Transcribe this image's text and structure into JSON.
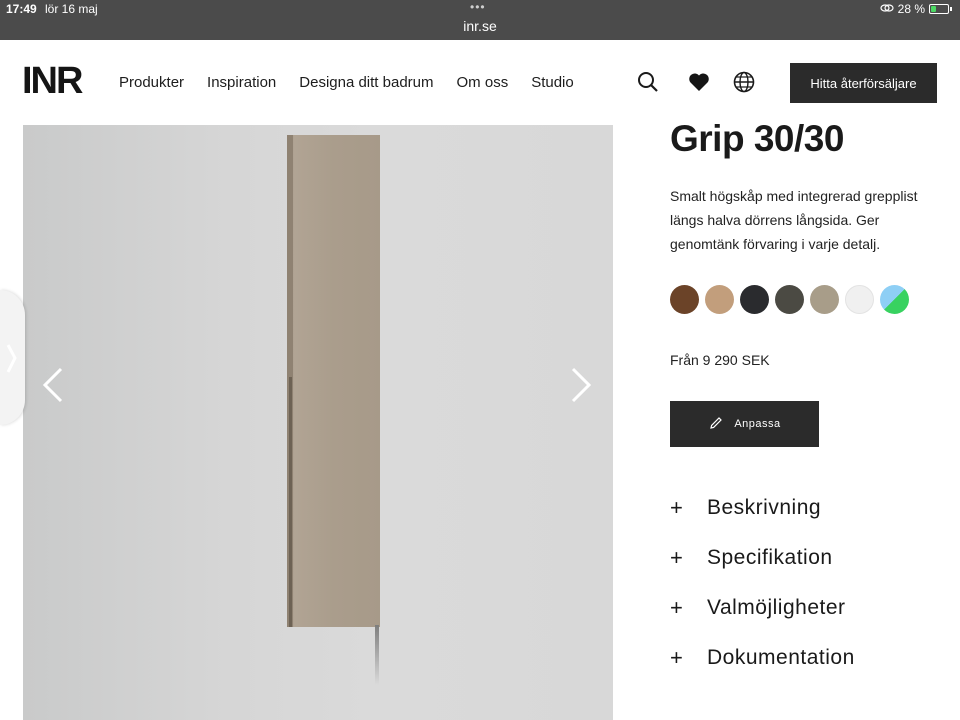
{
  "statusbar": {
    "time": "17:49",
    "date": "lör 16 maj",
    "url": "inr.se",
    "battery": "28 %",
    "battery_level": 0.28
  },
  "header": {
    "logo": "INR",
    "nav": [
      "Produkter",
      "Inspiration",
      "Designa ditt badrum",
      "Om oss",
      "Studio"
    ],
    "icons": [
      "search-icon",
      "heart-icon",
      "globe-icon"
    ],
    "dealer_button": "Hitta återförsäljare"
  },
  "product": {
    "title": "Grip 30/30",
    "description": "Smalt högskåp med integrerad grepplist längs halva dörrens långsida. Ger genomtänk förvaring i varje detalj.",
    "swatches": [
      "#6b4328",
      "#c29e7c",
      "#2a2b2e",
      "#4b4a43",
      "#a89d89",
      "#f0f0f0",
      "multicolor"
    ],
    "price": "Från 9 290 SEK",
    "customize_button": "Anpassa",
    "accordion": [
      "Beskrivning",
      "Specifikation",
      "Valmöjligheter",
      "Dokumentation"
    ]
  },
  "colors": {
    "dark_button": "#2b2b2b",
    "statusbar": "#4b4b4b"
  }
}
